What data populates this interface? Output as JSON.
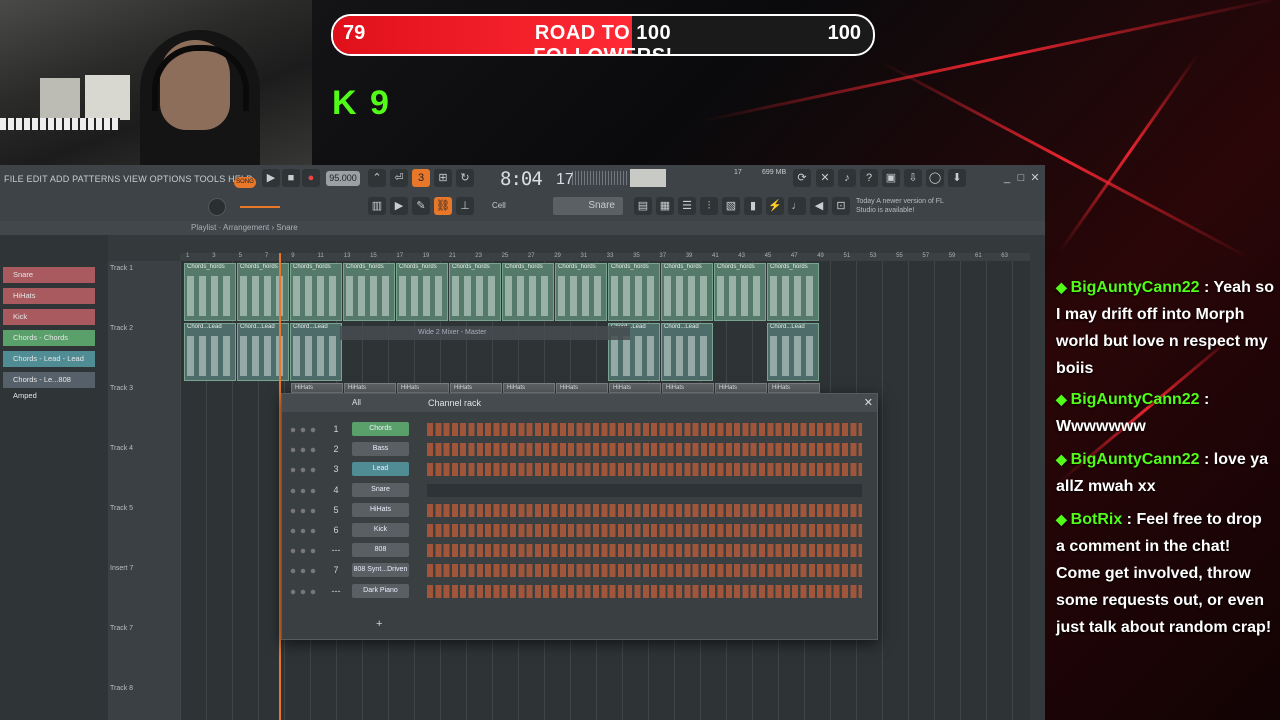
{
  "stream": {
    "goal_current": "79",
    "goal_title": "ROAD TO 100 FOLLOWERS!",
    "goal_target": "100",
    "goal_progress": 0.79,
    "kick_badge": "K 9"
  },
  "fl": {
    "menu": "FILE  EDIT  ADD  PATTERNS  VIEW  OPTIONS  TOOLS  HELP",
    "song_label": "SONG",
    "tempo": "95.000",
    "time_main": "8:04",
    "time_sec": "17",
    "cpu": "17",
    "memory": "699 MB",
    "cell_label": "Cell",
    "snap_value": "Snare",
    "news": "Today  A newer version of FL Studio is available!",
    "playlist_crumb": "Playlist · Arrangement › Snare",
    "patterns": [
      {
        "label": "Snare",
        "color": "#a85a5f"
      },
      {
        "label": "HiHats",
        "color": "#a85a5f"
      },
      {
        "label": "Kick",
        "color": "#a85a5f"
      },
      {
        "label": "Chords - Chords",
        "color": "#5aa06a"
      },
      {
        "label": "Chords - Lead - Lead",
        "color": "#4f8c94"
      },
      {
        "label": "Chords - Le...808 Amped",
        "color": "#55606a"
      }
    ],
    "tracks": [
      "Track 1",
      "Track 2",
      "Track 3",
      "Track 4",
      "Track 5",
      "Insert 7",
      "Track 7",
      "Track 8"
    ],
    "ruler": [
      "1",
      "3",
      "5",
      "7",
      "9",
      "11",
      "13",
      "15",
      "17",
      "19",
      "21",
      "23",
      "25",
      "27",
      "29",
      "31",
      "33",
      "35",
      "37",
      "39",
      "41",
      "43",
      "45",
      "47",
      "49",
      "51",
      "53",
      "55",
      "57",
      "59",
      "61",
      "63"
    ],
    "clip_chords": "Chords_hords",
    "clip_lead": "Chord...Lead",
    "clip_hihats": "HiHats",
    "mixer_ghost": "Wide 2          Mixer - Master",
    "rack": {
      "filter": "All",
      "title": "Channel rack",
      "channels": [
        {
          "num": "1",
          "name": "Chords",
          "style": "green"
        },
        {
          "num": "2",
          "name": "Bass",
          "style": "red"
        },
        {
          "num": "3",
          "name": "Lead",
          "style": "teal"
        },
        {
          "num": "4",
          "name": "Snare",
          "style": "red"
        },
        {
          "num": "5",
          "name": "HiHats",
          "style": "red"
        },
        {
          "num": "6",
          "name": "Kick",
          "style": "red"
        },
        {
          "num": "---",
          "name": "808",
          "style": "red"
        },
        {
          "num": "7",
          "name": "808 Synt...Driven",
          "style": "red"
        },
        {
          "num": "---",
          "name": "Dark Piano",
          "style": "red"
        }
      ]
    }
  },
  "chat": [
    {
      "user": "BigAuntyCann22",
      "text": "Yeah so I may drift off into Morph world but love n respect my boiis"
    },
    {
      "user": "BigAuntyCann22",
      "text": "Wwwwwww"
    },
    {
      "user": "BigAuntyCann22",
      "text": "love ya allZ mwah xx"
    },
    {
      "user": "BotRix",
      "text": "Feel free to drop a comment in the chat! Come get involved, throw some requests out, or even just talk about random crap!"
    }
  ]
}
